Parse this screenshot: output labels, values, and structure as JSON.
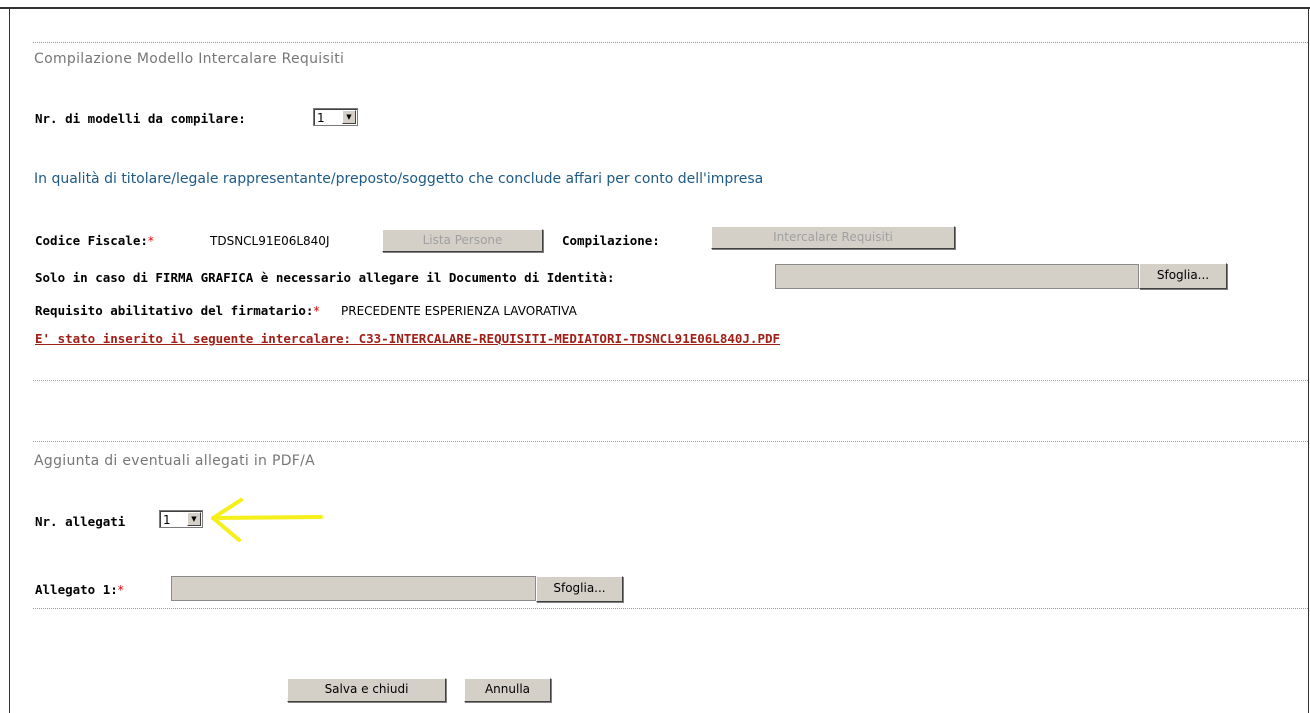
{
  "section1": {
    "title": "Compilazione Modello Intercalare Requisiti",
    "nr_modelli_label": "Nr. di modelli da compilare:",
    "nr_modelli_value": "1",
    "info_text": "In qualità di titolare/legale rappresentante/preposto/soggetto che conclude affari per conto dell'impresa",
    "codice_fiscale_label": "Codice Fiscale:",
    "codice_fiscale_value": "TDSNCL91E06L840J",
    "lista_persone_button": "Lista Persone",
    "compilazione_label": "Compilazione:",
    "intercalare_button": "Intercalare Requisiti",
    "firma_label": "Solo in caso di FIRMA GRAFICA è necessario allegare il Documento di Identità:",
    "sfoglia_button": "Sfoglia...",
    "requisito_label": "Requisito abilitativo del firmatario:",
    "requisito_value": "PRECEDENTE ESPERIENZA LAVORATIVA",
    "inserted_link": "E' stato inserito il seguente intercalare: C33-INTERCALARE-REQUISITI-MEDIATORI-TDSNCL91E06L840J.PDF",
    "required_mark": "*"
  },
  "section2": {
    "title": "Aggiunta di eventuali allegati in PDF/A",
    "nr_allegati_label": "Nr. allegati",
    "nr_allegati_value": "1",
    "allegato1_label": "Allegato 1:",
    "sfoglia_button": "Sfoglia...",
    "required_mark": "*"
  },
  "footer": {
    "save_button": "Salva e chiudi",
    "cancel_button": "Annulla"
  },
  "colors": {
    "annotation_arrow": "#f5ef1a",
    "link": "#a02018",
    "info_text": "#1e5a86"
  },
  "icons": {
    "select_arrow": "triangle-down-icon",
    "annotation": "yellow-arrow-left-icon"
  }
}
